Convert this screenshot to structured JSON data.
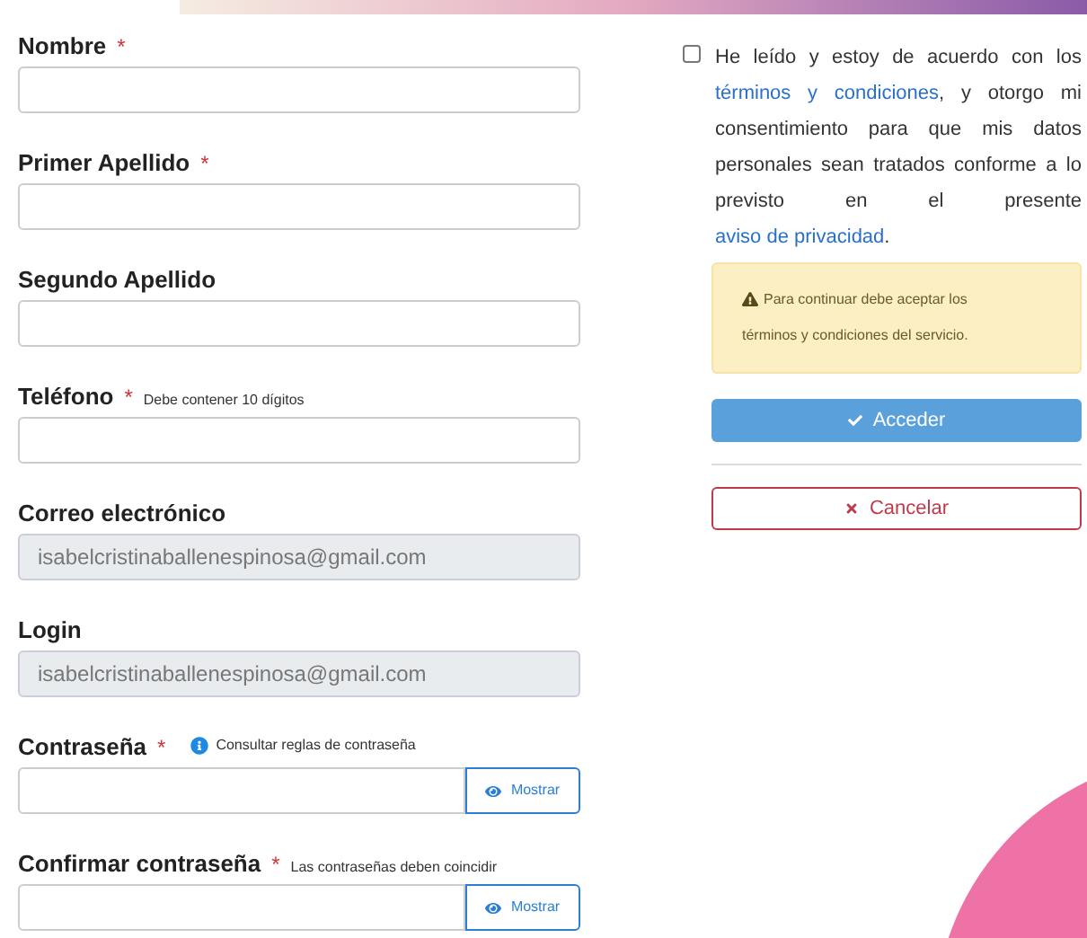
{
  "form": {
    "fields": [
      {
        "kind": "text",
        "label": "Nombre",
        "required_mark": "*"
      },
      {
        "kind": "text",
        "label": "Primer Apellido",
        "required_mark": "*"
      },
      {
        "kind": "text",
        "label": "Segundo Apellido"
      },
      {
        "kind": "text",
        "label": "Teléfono",
        "required_mark": "*",
        "hint": "Debe contener 10 dígitos"
      },
      {
        "kind": "readonly",
        "label": "Correo electrónico",
        "value": "isabelcristinaballenespinosa@gmail.com"
      },
      {
        "kind": "readonly",
        "label": "Login",
        "value": "isabelcristinaballenespinosa@gmail.com"
      },
      {
        "kind": "password",
        "label": "Contraseña",
        "required_mark": "*",
        "info": "Consultar reglas de contraseña",
        "button": "Mostrar"
      },
      {
        "kind": "password",
        "label": "Confirmar contraseña",
        "required_mark": "*",
        "hint": "Las contraseñas deben coincidir",
        "button": "Mostrar"
      }
    ]
  },
  "consent": {
    "checked": false,
    "parts": [
      {
        "kind": "text",
        "text": "He leído y estoy de acuerdo con los"
      },
      {
        "kind": "link",
        "text": "términos y condiciones"
      },
      {
        "kind": "text",
        "text": ", y otorgo mi consentimiento para que mis datos personales sean tratados conforme a lo previsto en el presente"
      },
      {
        "kind": "link",
        "text": "aviso de privacidad"
      },
      {
        "kind": "text",
        "text": "."
      }
    ]
  },
  "warning": {
    "text": "Para continuar debe aceptar los términos y condiciones del servicio."
  },
  "actions": [
    {
      "kind": "primary",
      "label": "Acceder"
    },
    {
      "kind": "danger",
      "label": "Cancelar"
    }
  ]
}
